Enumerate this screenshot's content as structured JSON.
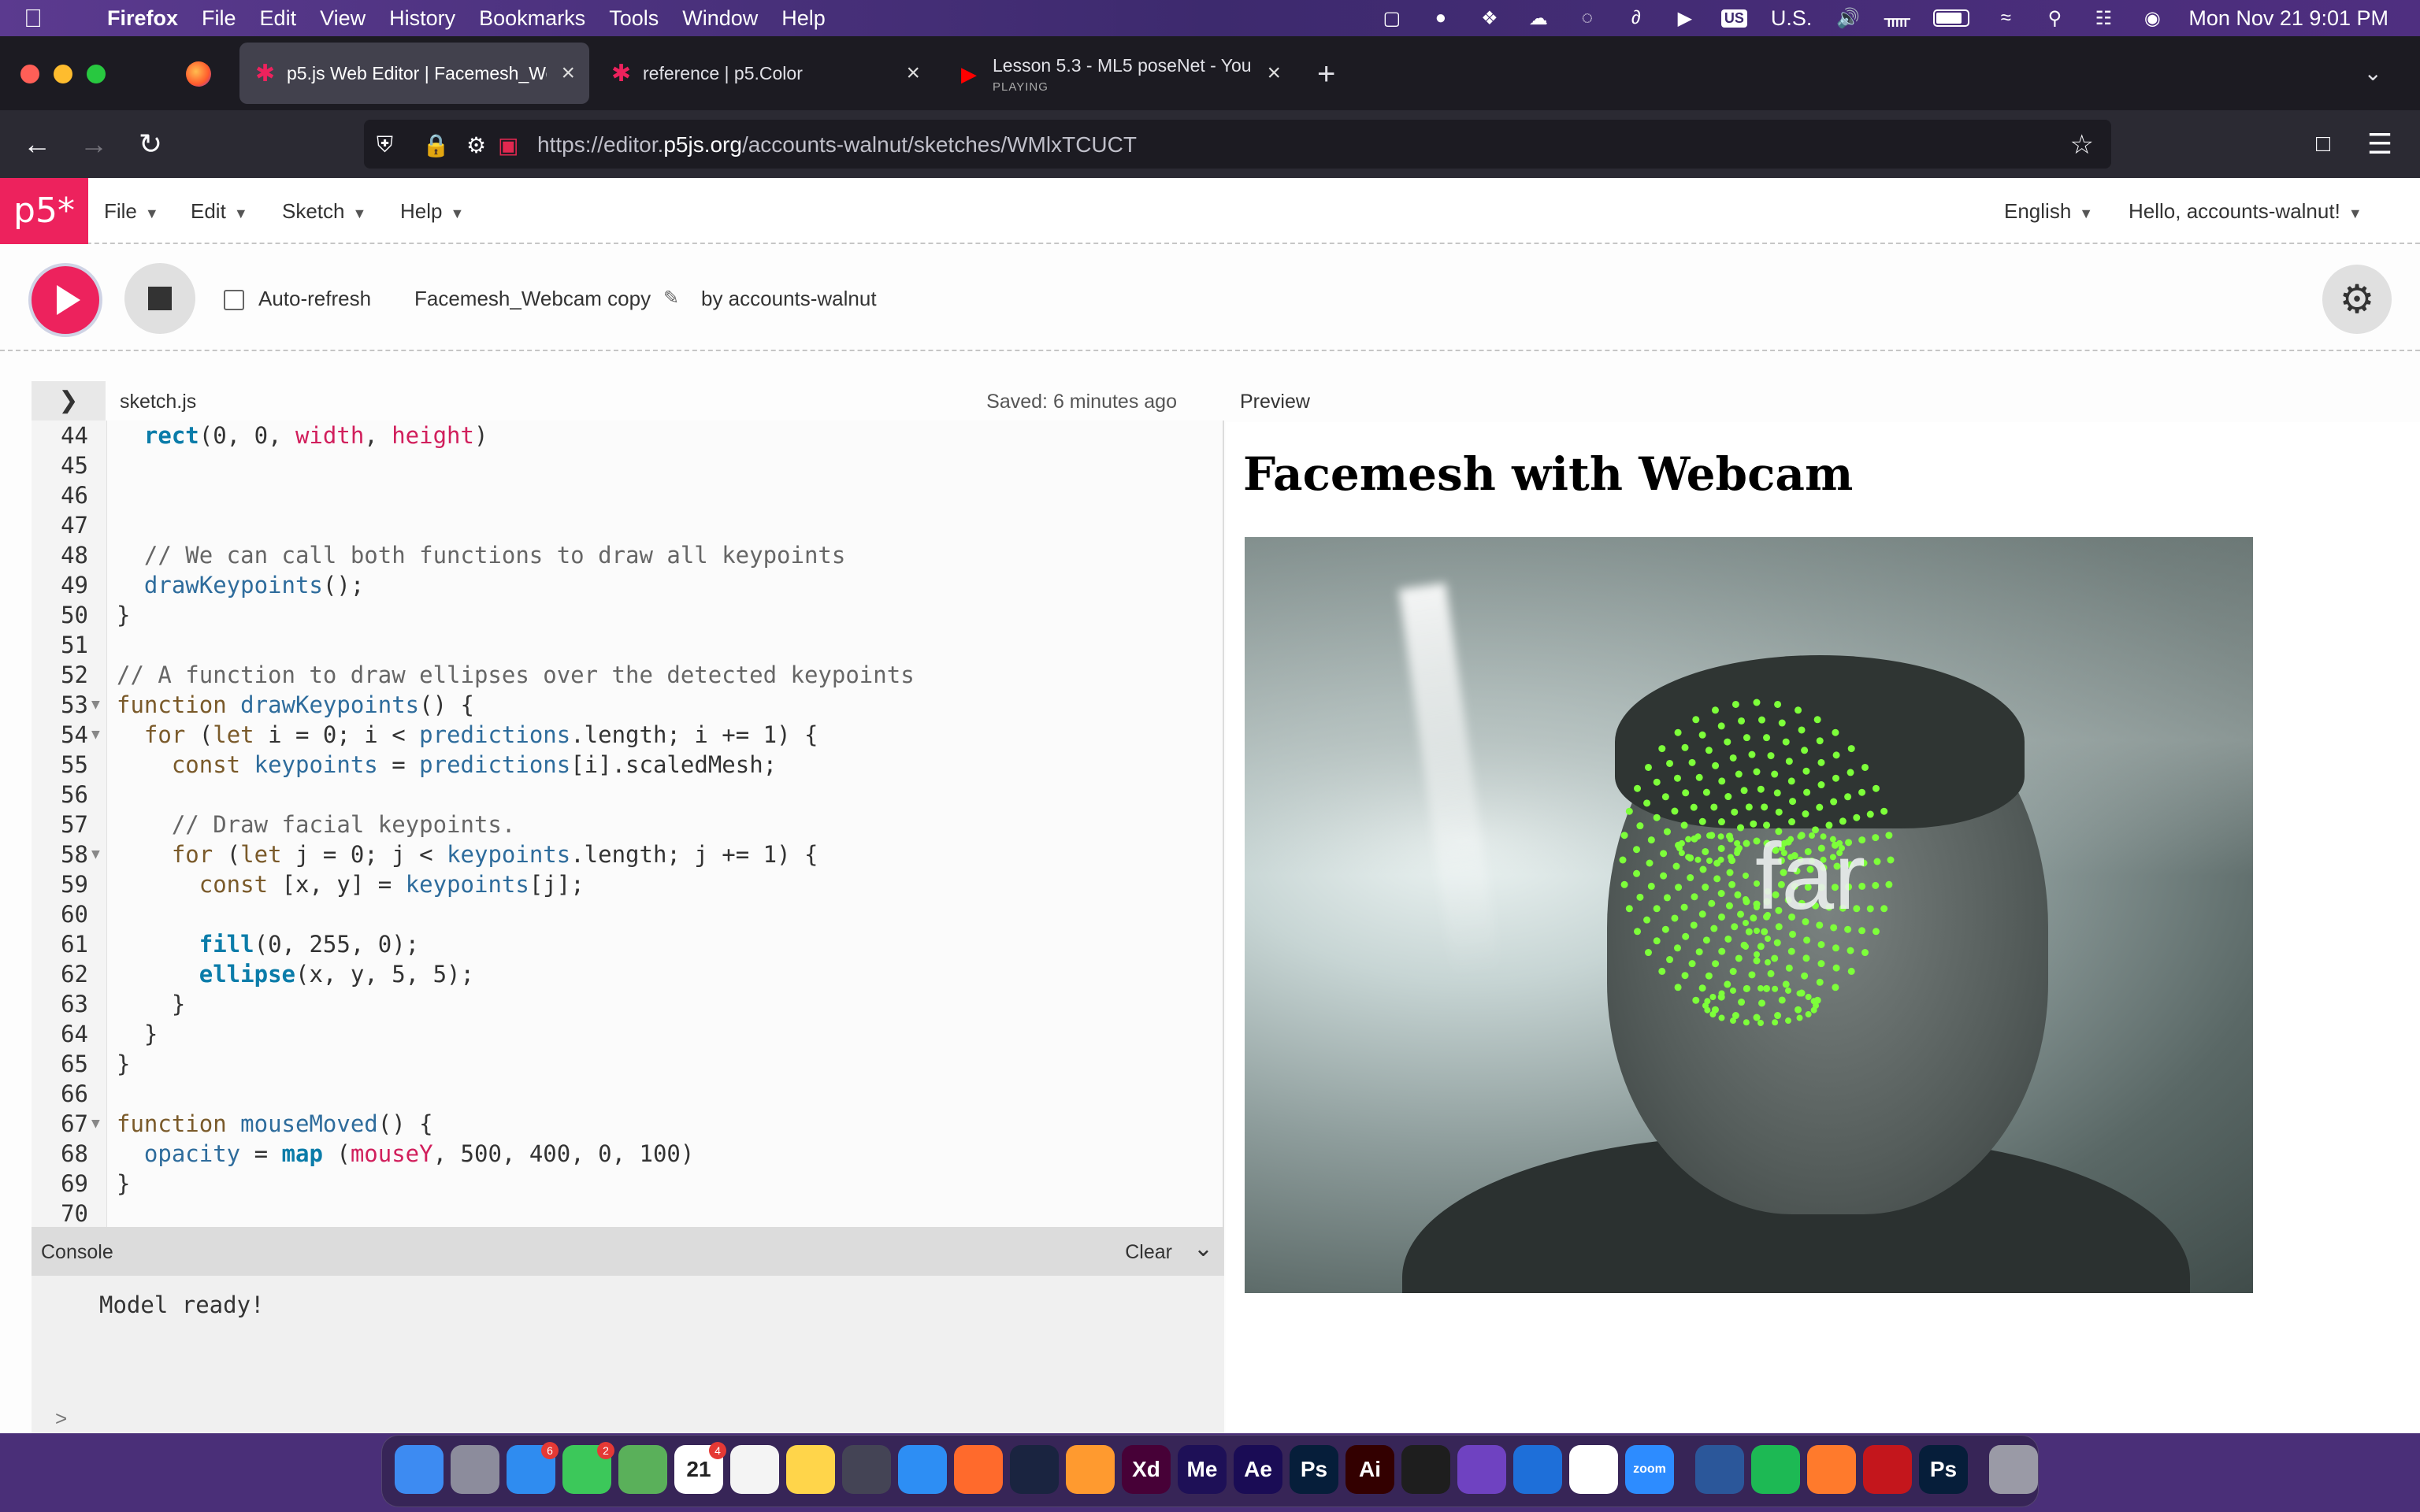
{
  "menubar": {
    "app": "Firefox",
    "items": [
      "File",
      "Edit",
      "View",
      "History",
      "Bookmarks",
      "Tools",
      "Window",
      "Help"
    ],
    "input_source": "U.S.",
    "clock": "Mon Nov 21  9:01 PM"
  },
  "tabs": [
    {
      "label": "p5.js Web Editor | Facemesh_We",
      "active": true
    },
    {
      "label": "reference | p5.Color",
      "active": false
    },
    {
      "label": "Lesson 5.3 - ML5 poseNet - You",
      "status": "PLAYING",
      "active": false
    }
  ],
  "address": {
    "prefix": "https://editor.",
    "domain": "p5js.org",
    "path": "/accounts-walnut/sketches/WMlxTCUCT"
  },
  "p5nav": {
    "logo": "p5*",
    "menus": [
      "File",
      "Edit",
      "Sketch",
      "Help"
    ],
    "language": "English",
    "greeting": "Hello, accounts-walnut!"
  },
  "toolbar": {
    "auto_refresh_label": "Auto-refresh",
    "auto_refresh_checked": false,
    "sketch_name": "Facemesh_Webcam copy",
    "byline": "by accounts-walnut"
  },
  "file": {
    "name": "sketch.js",
    "saved": "Saved: 6 minutes ago"
  },
  "code_lines": [
    {
      "n": "44",
      "t": "  rect(0, 0, width, height)"
    },
    {
      "n": "45",
      "t": ""
    },
    {
      "n": "46",
      "t": ""
    },
    {
      "n": "47",
      "t": ""
    },
    {
      "n": "48",
      "t": "  // We can call both functions to draw all keypoints"
    },
    {
      "n": "49",
      "t": "  drawKeypoints();"
    },
    {
      "n": "50",
      "t": "}"
    },
    {
      "n": "51",
      "t": ""
    },
    {
      "n": "52",
      "t": "// A function to draw ellipses over the detected keypoints"
    },
    {
      "n": "53",
      "t": "function drawKeypoints() {",
      "fold": true
    },
    {
      "n": "54",
      "t": "  for (let i = 0; i < predictions.length; i += 1) {",
      "fold": true
    },
    {
      "n": "55",
      "t": "    const keypoints = predictions[i].scaledMesh;"
    },
    {
      "n": "56",
      "t": ""
    },
    {
      "n": "57",
      "t": "    // Draw facial keypoints."
    },
    {
      "n": "58",
      "t": "    for (let j = 0; j < keypoints.length; j += 1) {",
      "fold": true
    },
    {
      "n": "59",
      "t": "      const [x, y] = keypoints[j];"
    },
    {
      "n": "60",
      "t": ""
    },
    {
      "n": "61",
      "t": "      fill(0, 255, 0);"
    },
    {
      "n": "62",
      "t": "      ellipse(x, y, 5, 5);"
    },
    {
      "n": "63",
      "t": "    }"
    },
    {
      "n": "64",
      "t": "  }"
    },
    {
      "n": "65",
      "t": "}"
    },
    {
      "n": "66",
      "t": ""
    },
    {
      "n": "67",
      "t": "function mouseMoved() {",
      "fold": true
    },
    {
      "n": "68",
      "t": "  opacity = map (mouseY, 500, 400, 0, 100)"
    },
    {
      "n": "69",
      "t": "}"
    },
    {
      "n": "70",
      "t": ""
    }
  ],
  "console": {
    "title": "Console",
    "clear_label": "Clear",
    "message": "Model ready!",
    "prompt": ">"
  },
  "preview": {
    "label": "Preview",
    "heading": "Facemesh with Webcam",
    "overlay_text": "far",
    "keypoint_color": "#7dff3a"
  },
  "dock": {
    "items": [
      {
        "name": "finder",
        "color": "#3d8bf2"
      },
      {
        "name": "launchpad",
        "color": "#8c8c9c"
      },
      {
        "name": "mail",
        "color": "#2f8cf0",
        "badge": "6"
      },
      {
        "name": "messages",
        "color": "#3cc85a",
        "badge": "2"
      },
      {
        "name": "maps",
        "color": "#5ab05a"
      },
      {
        "name": "calendar",
        "color": "#ffffff",
        "label": "21",
        "badge": "4",
        "month": "NOV"
      },
      {
        "name": "reminders",
        "color": "#f4f4f4"
      },
      {
        "name": "notes",
        "color": "#ffd54a"
      },
      {
        "name": "quicktime",
        "color": "#445"
      },
      {
        "name": "safari",
        "color": "#2d8ef4"
      },
      {
        "name": "firefox",
        "color": "#ff6a2c"
      },
      {
        "name": "cinema4d",
        "color": "#1a2440"
      },
      {
        "name": "pages",
        "color": "#ff9a2f"
      },
      {
        "name": "xd",
        "color": "#470137",
        "label": "Xd"
      },
      {
        "name": "media-encoder",
        "color": "#1e1057",
        "label": "Me"
      },
      {
        "name": "after-effects",
        "color": "#1a0c55",
        "label": "Ae"
      },
      {
        "name": "photoshop",
        "color": "#061e3a",
        "label": "Ps"
      },
      {
        "name": "illustrator",
        "color": "#330000",
        "label": "Ai"
      },
      {
        "name": "figma",
        "color": "#1e1e1e"
      },
      {
        "name": "github-desktop",
        "color": "#6f42c1"
      },
      {
        "name": "vscode",
        "color": "#1e6fd9"
      },
      {
        "name": "slack",
        "color": "#ffffff"
      },
      {
        "name": "zoom",
        "color": "#2d8cff",
        "label": "zoom"
      },
      {
        "name": "word",
        "color": "#2b579a"
      },
      {
        "name": "spotify",
        "color": "#1db954"
      },
      {
        "name": "firefox-dev",
        "color": "#ff7a2c"
      },
      {
        "name": "acrobat",
        "color": "#c4161c"
      },
      {
        "name": "photoshop-2",
        "color": "#061e3a",
        "label": "Ps"
      },
      {
        "name": "trash",
        "color": "#9a9aa6"
      }
    ]
  }
}
